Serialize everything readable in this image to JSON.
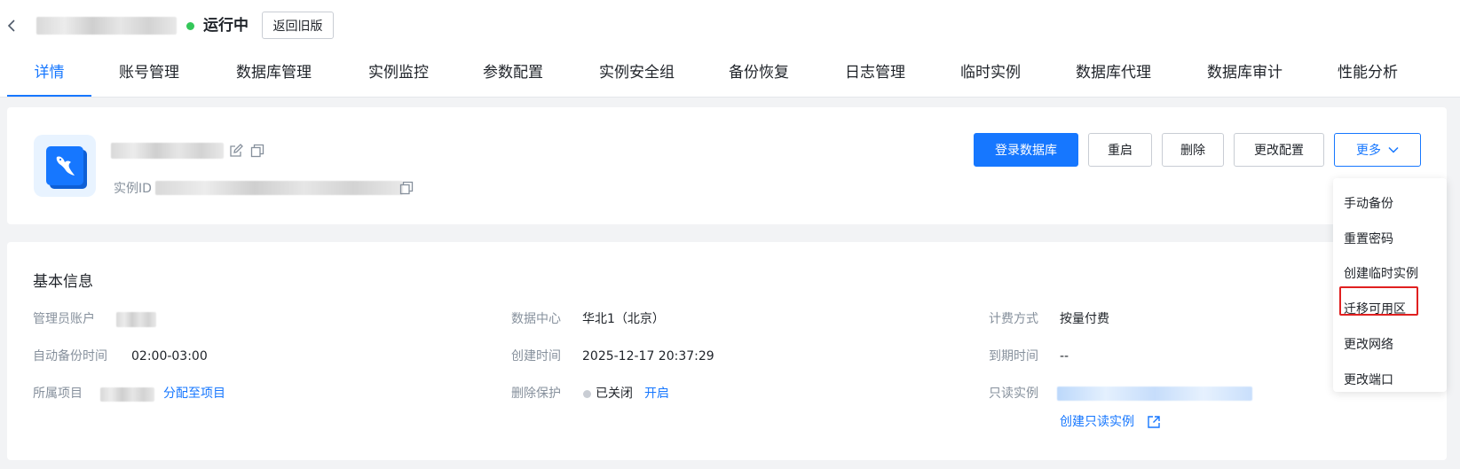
{
  "header": {
    "status_text": "运行中",
    "status_color": "#34c759",
    "old_version_label": "返回旧版"
  },
  "tabs": [
    {
      "label": "详情"
    },
    {
      "label": "账号管理"
    },
    {
      "label": "数据库管理"
    },
    {
      "label": "实例监控"
    },
    {
      "label": "参数配置"
    },
    {
      "label": "实例安全组"
    },
    {
      "label": "备份恢复"
    },
    {
      "label": "日志管理"
    },
    {
      "label": "临时实例"
    },
    {
      "label": "数据库代理"
    },
    {
      "label": "数据库审计"
    },
    {
      "label": "性能分析"
    }
  ],
  "instance": {
    "id_label": "实例ID",
    "logo_icon": "mysql-dolphin-icon"
  },
  "actions": {
    "login_label": "登录数据库",
    "restart_label": "重启",
    "delete_label": "删除",
    "change_config_label": "更改配置",
    "more_label": "更多"
  },
  "more_menu": {
    "items": [
      {
        "label": "手动备份"
      },
      {
        "label": "重置密码"
      },
      {
        "label": "创建临时实例"
      },
      {
        "label": "迁移可用区"
      },
      {
        "label": "更改网络"
      },
      {
        "label": "更改端口"
      }
    ],
    "highlighted": "迁移可用区"
  },
  "basic_info": {
    "title": "基本信息",
    "admin_account_label": "管理员账户",
    "auto_backup_label": "自动备份时间",
    "auto_backup_value": "02:00-03:00",
    "project_label": "所属项目",
    "assign_project_link": "分配至项目",
    "datacenter_label": "数据中心",
    "datacenter_value": "华北1（北京）",
    "created_label": "创建时间",
    "created_value": "2025-12-17 20:37:29",
    "delete_protect_label": "删除保护",
    "delete_protect_value": "已关闭",
    "delete_protect_link": "开启",
    "billing_label": "计费方式",
    "billing_value": "按量付费",
    "expire_label": "到期时间",
    "expire_value": "--",
    "readonly_label": "只读实例",
    "create_readonly_link": "创建只读实例"
  },
  "colors": {
    "accent": "#1677ff",
    "highlight_border": "#e02020"
  }
}
